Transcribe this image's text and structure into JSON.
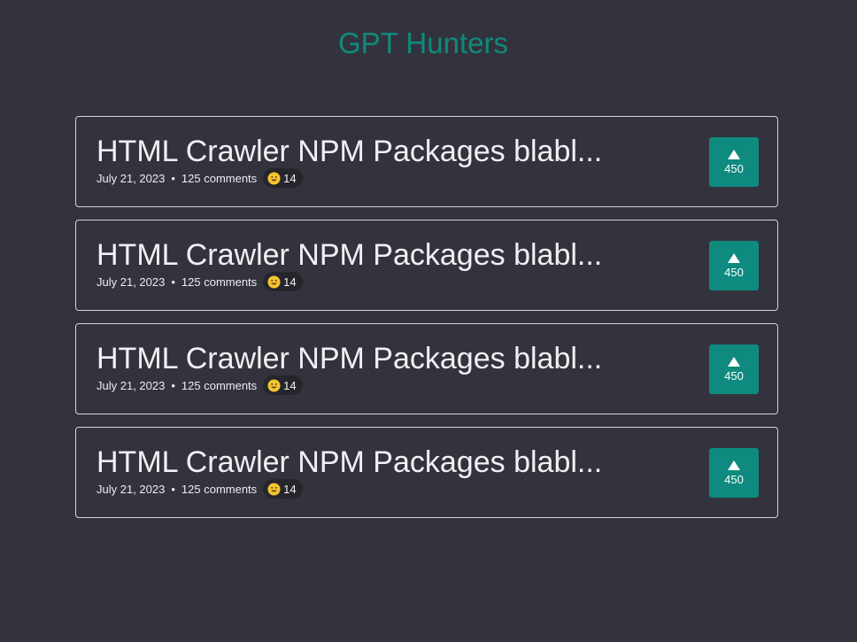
{
  "header": {
    "title": "GPT Hunters"
  },
  "posts": [
    {
      "title": "HTML Crawler NPM Packages blabl...",
      "date": "July 21, 2023",
      "separator": "•",
      "comments": "125 comments",
      "reaction_icon": "smiley-emoji-icon",
      "reaction_count": "14",
      "vote_icon": "upvote-triangle-icon",
      "votes": "450"
    },
    {
      "title": "HTML Crawler NPM Packages blabl...",
      "date": "July 21, 2023",
      "separator": "•",
      "comments": "125 comments",
      "reaction_icon": "smiley-emoji-icon",
      "reaction_count": "14",
      "vote_icon": "upvote-triangle-icon",
      "votes": "450"
    },
    {
      "title": "HTML Crawler NPM Packages blabl...",
      "date": "July 21, 2023",
      "separator": "•",
      "comments": "125 comments",
      "reaction_icon": "smiley-emoji-icon",
      "reaction_count": "14",
      "vote_icon": "upvote-triangle-icon",
      "votes": "450"
    },
    {
      "title": "HTML Crawler NPM Packages blabl...",
      "date": "July 21, 2023",
      "separator": "•",
      "comments": "125 comments",
      "reaction_icon": "smiley-emoji-icon",
      "reaction_count": "14",
      "vote_icon": "upvote-triangle-icon",
      "votes": "450"
    }
  ],
  "colors": {
    "background": "#33333d",
    "accent": "#0f8a7e",
    "card_border": "#d4d4da",
    "badge_background": "#25252c"
  }
}
